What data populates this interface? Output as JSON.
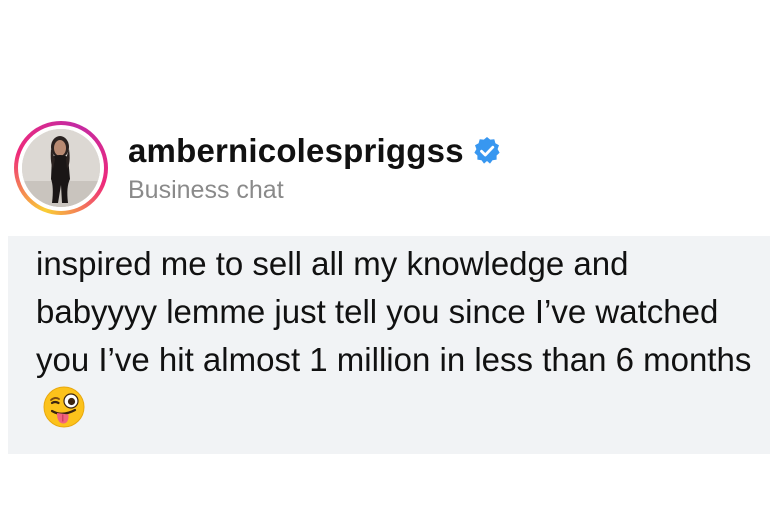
{
  "chat": {
    "username": "ambernicolespriggss",
    "subtitle": "Business chat",
    "verified": true
  },
  "message": {
    "text": "inspired me to sell all my knowledge and babyyyy lemme just tell you since I’ve watched you I’ve hit almost 1 million in less than 6 months",
    "emoji": "winking-face-with-tongue-icon"
  },
  "colors": {
    "verified_badge": "#3897f0",
    "message_background": "#f1f3f5",
    "subtitle": "#8a8a8a"
  }
}
